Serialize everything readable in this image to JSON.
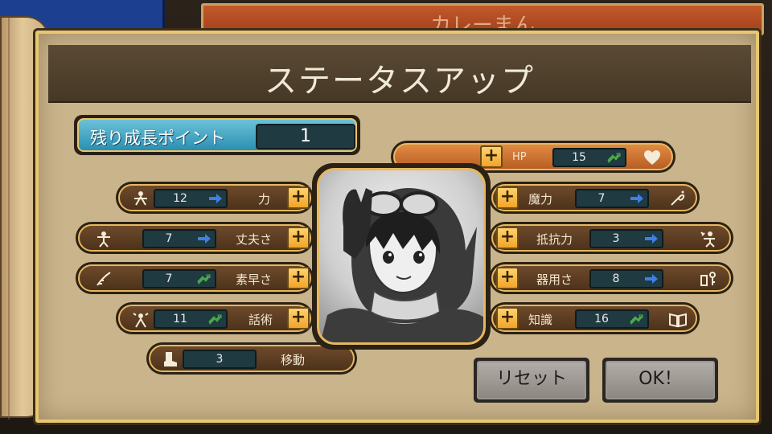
{
  "background": {
    "banner_text": "カレーまん"
  },
  "title": "ステータスアップ",
  "growth": {
    "label": "残り成長ポイント",
    "value": "1"
  },
  "stats_left": [
    {
      "name": "力",
      "value": "12",
      "arrow": "right-arrow",
      "arrow_color": "#3f7fe6",
      "icon": "strength-icon"
    },
    {
      "name": "丈夫さ",
      "value": "7",
      "arrow": "right-arrow",
      "arrow_color": "#3f7fe6",
      "icon": "toughness-icon"
    },
    {
      "name": "素早さ",
      "value": "7",
      "arrow": "up-arrow",
      "arrow_color": "#4aa84a",
      "icon": "speed-icon"
    },
    {
      "name": "話術",
      "value": "11",
      "arrow": "up-arrow",
      "arrow_color": "#4aa84a",
      "icon": "speech-icon"
    },
    {
      "name": "移動",
      "value": "3",
      "icon": "boot-icon"
    }
  ],
  "stats_right": [
    {
      "name": "HP",
      "value": "15",
      "arrow": "up-arrow",
      "arrow_color": "#4aa84a",
      "icon": "heart-icon"
    },
    {
      "name": "魔力",
      "value": "7",
      "arrow": "right-arrow",
      "arrow_color": "#3f7fe6",
      "icon": "magic-icon"
    },
    {
      "name": "抵抗力",
      "value": "3",
      "arrow": "right-arrow",
      "arrow_color": "#3f7fe6",
      "icon": "resistance-icon"
    },
    {
      "name": "器用さ",
      "value": "8",
      "arrow": "right-arrow",
      "arrow_color": "#3f7fe6",
      "icon": "dexterity-icon"
    },
    {
      "name": "知識",
      "value": "16",
      "arrow": "up-arrow",
      "arrow_color": "#4aa84a",
      "icon": "book-icon"
    }
  ],
  "plus_label": "+",
  "buttons": {
    "reset": "リセット",
    "ok": "OK！"
  }
}
